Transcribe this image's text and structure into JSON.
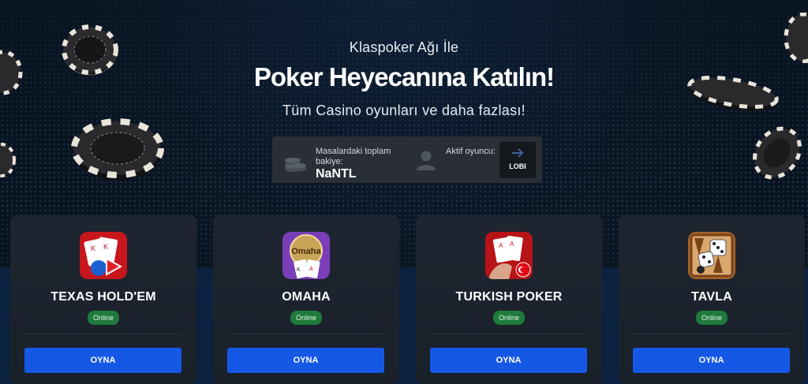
{
  "hero": {
    "subtitle": "Klaspoker Ağı İle",
    "title": "Poker Heyecanına Katılın!",
    "tagline": "Tüm Casino oyunları ve daha fazlası!"
  },
  "stats": {
    "balance_label": "Masalardaki toplam bakiye:",
    "balance_value": "NaNTL",
    "active_players_label": "Aktif oyuncu:",
    "lobby_label": "LOBI",
    "icons": [
      "coins-icon",
      "user-icon",
      "arrow-right-icon"
    ]
  },
  "games": [
    {
      "name": "TEXAS HOLD'EM",
      "status": "Online",
      "button": "OYNA",
      "icon": "texas-holdem-icon"
    },
    {
      "name": "OMAHA",
      "status": "Online",
      "button": "OYNA",
      "icon": "omaha-icon",
      "icon_text": "Omaha"
    },
    {
      "name": "TURKISH POKER",
      "status": "Online",
      "button": "OYNA",
      "icon": "turkish-poker-icon"
    },
    {
      "name": "TAVLA",
      "status": "Online",
      "button": "OYNA",
      "icon": "tavla-icon"
    }
  ],
  "colors": {
    "background": "#0a1624",
    "card": "#1e2530",
    "button": "#1658e6",
    "badge": "#1f7a3c",
    "stats_panel": "#2a2f36"
  }
}
